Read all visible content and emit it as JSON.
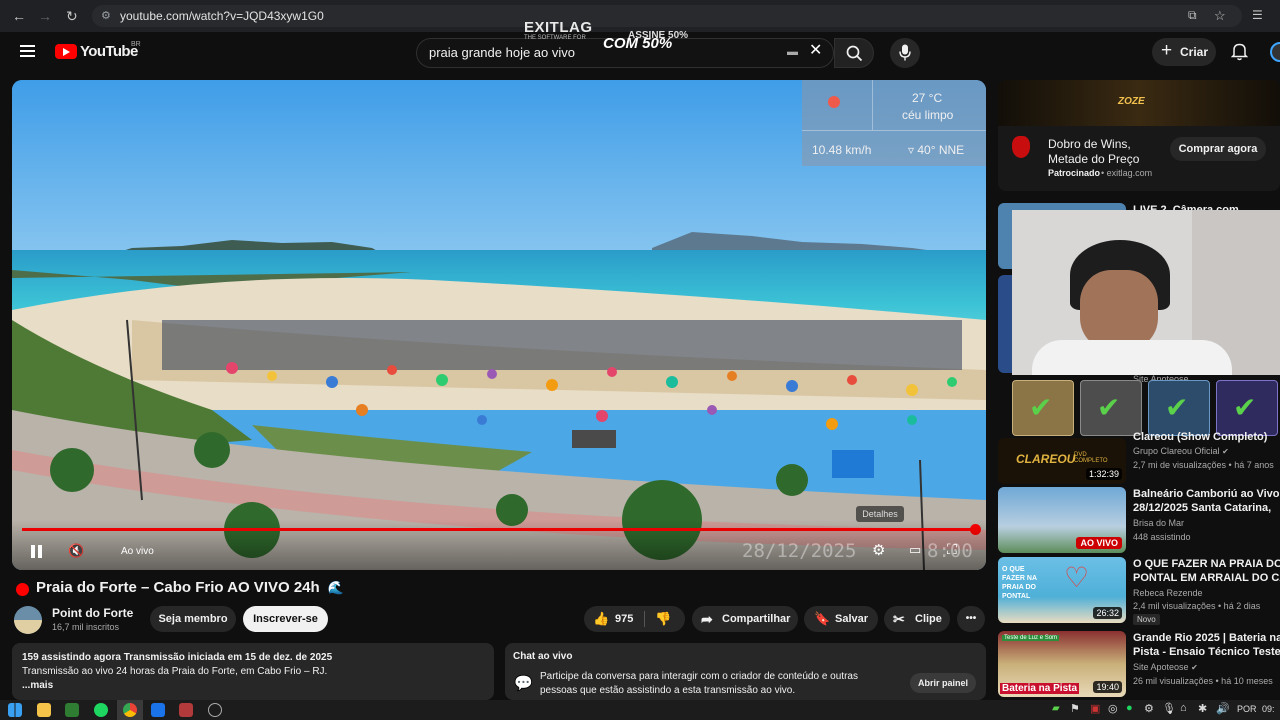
{
  "browser": {
    "url": "youtube.com/watch?v=JQD43xyw1G0"
  },
  "header": {
    "logo_text": "YouTube",
    "region": "BR",
    "search_value": "praia grande hoje ao vivo",
    "create_label": "Criar",
    "overlay_ad": {
      "brand": "EXITLAG",
      "tagline": "THE SOFTWARE FOR",
      "offer_line1": "ASSINE 50%",
      "offer_line2": "COM 50%"
    }
  },
  "video": {
    "weather": {
      "temp": "27 °C",
      "sky": "céu limpo",
      "wind_speed": "10.48 km/h",
      "wind_dir": "▿ 40° NNE"
    },
    "live_label": "Ao vivo",
    "details_label": "Detalhes",
    "timestamp_overlay": "28/12/2025",
    "time_overlay": "8:00",
    "progress": 1.0
  },
  "meta": {
    "title": "Praia do Forte – Cabo Frio AO VIVO 24h",
    "title_emoji": "🌊",
    "channel": "Point do Forte",
    "subscribers": "16,7 mil inscritos",
    "member_label": "Seja membro",
    "subscribe_label": "Inscrever-se",
    "likes": "975",
    "share_label": "Compartilhar",
    "save_label": "Salvar",
    "clip_label": "Clipe",
    "more_label": "•••"
  },
  "description": {
    "line1": "159 assistindo agora  Transmissão iniciada em 15 de dez. de 2025",
    "line2": "Transmissão ao vivo 24 horas da Praia do Forte, em Cabo Frio – RJ.",
    "more": "...mais"
  },
  "chat": {
    "title": "Chat ao vivo",
    "text": "Participe da conversa para interagir com o criador de conteúdo e outras pessoas que estão assistindo a esta transmissão ao vivo.",
    "open_label": "Abrir painel"
  },
  "sidebar": {
    "ad": {
      "title_line1": "Dobro de Wins,",
      "title_line2": "Metade do Preço",
      "sponsored": "Patrocinado",
      "domain": "exitlag.com",
      "button": "Comprar agora",
      "banner_text": "ZOZE"
    },
    "items": [
      {
        "title": "LIVE 2. Câmera com",
        "meta1": "",
        "meta2": "",
        "badge": ""
      },
      {
        "title": "",
        "meta1": "Site Apoteose",
        "meta2": "",
        "badge": ""
      },
      {
        "title": "Clareou (Show Completo)",
        "meta1": "Grupo Clareou Oficial",
        "meta2": "2,7 mi de visualizações • há 7 anos",
        "badge": "1:32:39",
        "thumb_text": "CLAREOU",
        "thumb_sub": "DVD COMPLETO"
      },
      {
        "title": "Balneário Camboriú ao Vivo.",
        "title2": "28/12/2025 Santa Catarina,",
        "meta1": "Brisa do Mar",
        "meta2": "448 assistindo",
        "badge": "AO VIVO"
      },
      {
        "title": "O QUE FAZER NA PRAIA DO",
        "title2": "PONTAL EM ARRAIAL DO CAB",
        "meta1": "Rebeca Rezende",
        "meta2": "2,4 mil visualizações • há 2 dias",
        "tag": "Novo",
        "badge": "26:32",
        "thumb_text": "O QUE FAZER NA PRAIA DO PONTAL"
      },
      {
        "title": "Grande Rio 2025 | Bateria na",
        "title2": "Pista  - Ensaio Técnico Teste",
        "meta1": "Site Apoteose",
        "meta2": "26 mil visualizações • há 10 meses",
        "badge": "19:40",
        "thumb_text": "Bateria na Pista",
        "thumb_top": "Teste de Luz e Som"
      }
    ]
  },
  "taskbar": {
    "lang": "POR",
    "clock": "09:"
  },
  "colors": {
    "accent": "#ff0000",
    "bg": "#0f0f0f",
    "surface": "#272727",
    "subscribe_bg": "#f1f1f1"
  }
}
